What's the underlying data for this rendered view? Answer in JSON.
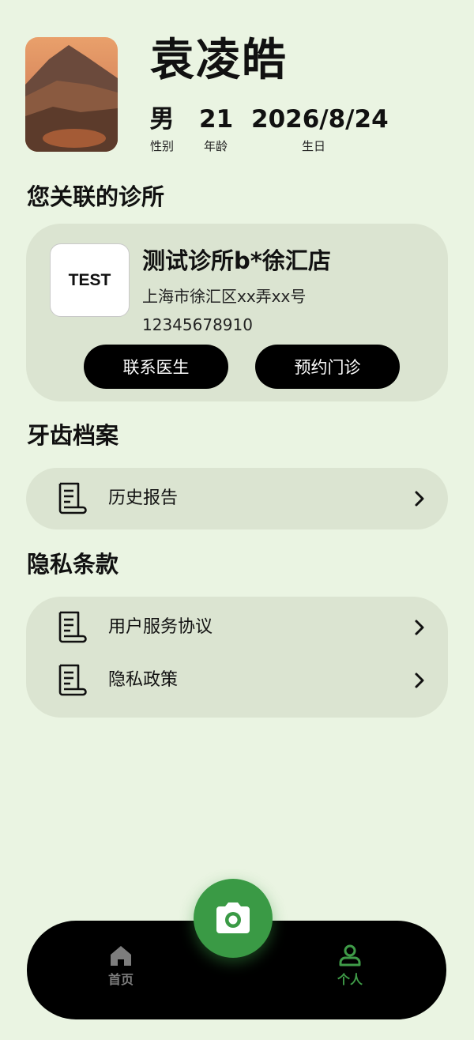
{
  "profile": {
    "name": "袁凌皓",
    "gender": "男",
    "gender_label": "性别",
    "age": "21",
    "age_label": "年龄",
    "birthday": "2026/8/24",
    "birthday_label": "生日"
  },
  "clinic_section": {
    "title": "您关联的诊所",
    "logo_text": "TEST",
    "name": "测试诊所b*徐汇店",
    "address": "上海市徐汇区xx弄xx号",
    "phone": "12345678910",
    "contact_button": "联系医生",
    "book_button": "预约门诊"
  },
  "dental_section": {
    "title": "牙齿档案",
    "items": [
      {
        "label": "历史报告",
        "icon": "document-icon"
      }
    ]
  },
  "privacy_section": {
    "title": "隐私条款",
    "items": [
      {
        "label": "用户服务协议",
        "icon": "document-icon"
      },
      {
        "label": "隐私政策",
        "icon": "document-icon"
      }
    ]
  },
  "bottom_nav": {
    "home_label": "首页",
    "me_label": "个人",
    "camera_icon": "camera-icon",
    "active": "个人"
  },
  "colors": {
    "background": "#eaf4e2",
    "card": "#dbe4d1",
    "accent_green": "#3a9a45",
    "inactive_gray": "#7d7d7d"
  }
}
